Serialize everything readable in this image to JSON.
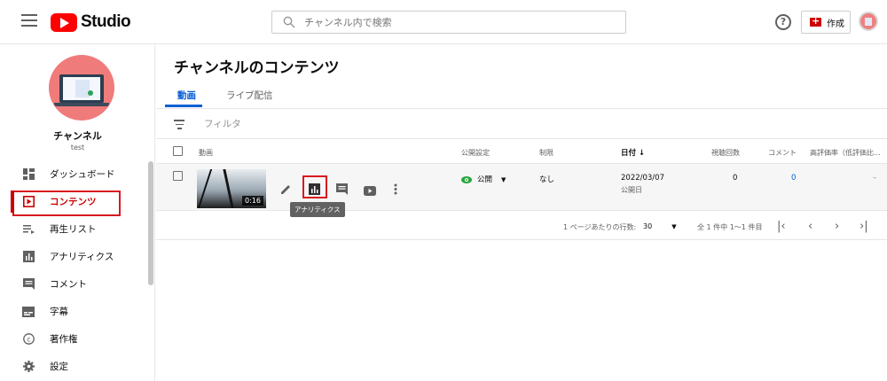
{
  "topbar": {
    "logo_text": "Studio",
    "search_placeholder": "チャンネル内で検索",
    "help": "?",
    "create_label": "作成"
  },
  "sidebar": {
    "channel_name": "チャンネル",
    "channel_sub": "test",
    "items": [
      {
        "label": "ダッシュボード",
        "icon": "dashboard-icon"
      },
      {
        "label": "コンテンツ",
        "icon": "content-icon",
        "active": true
      },
      {
        "label": "再生リスト",
        "icon": "playlist-icon"
      },
      {
        "label": "アナリティクス",
        "icon": "analytics-icon"
      },
      {
        "label": "コメント",
        "icon": "comment-icon"
      },
      {
        "label": "字幕",
        "icon": "subtitles-icon"
      },
      {
        "label": "著作権",
        "icon": "copyright-icon"
      },
      {
        "label": "設定",
        "icon": "gear-icon"
      }
    ]
  },
  "main": {
    "title": "チャンネルのコンテンツ",
    "tabs": [
      {
        "label": "動画"
      },
      {
        "label": "ライブ配信"
      }
    ],
    "filter_label": "フィルタ",
    "columns": {
      "video": "動画",
      "visibility": "公開設定",
      "restrictions": "制限",
      "date": "日付 ↓",
      "views": "視聴回数",
      "comments": "コメント",
      "likes": "高評価率（低評価比..."
    },
    "row": {
      "duration": "0:16",
      "visibility": "公開",
      "restrictions": "なし",
      "date": "2022/03/07",
      "date_sub": "公開日",
      "views": "0",
      "comments": "0",
      "likes": "–"
    },
    "tooltip": "アナリティクス",
    "pager": {
      "rows_per_page_label": "1 ページあたりの行数:",
      "rows_per_page": "30",
      "range": "全 1 件中 1～1 件目"
    }
  },
  "colors": {
    "accent_red": "#cc0000",
    "link_blue": "#065fd4",
    "visibility_green": "#2ba640"
  }
}
